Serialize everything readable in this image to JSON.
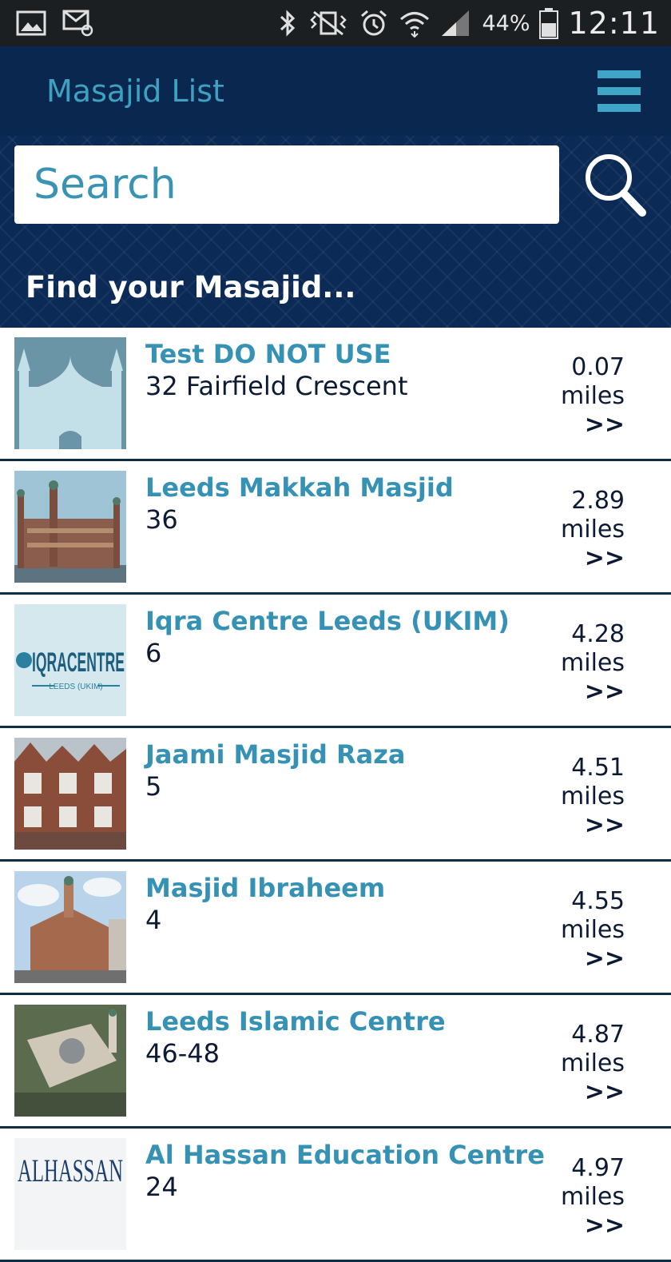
{
  "status_bar": {
    "battery": "44%",
    "time": "12:11",
    "icons": [
      "image-icon",
      "mail-icon",
      "bluetooth-icon",
      "vibrate-icon",
      "alarm-icon",
      "wifi-icon",
      "signal-icon",
      "battery-icon"
    ]
  },
  "app_bar": {
    "title": "Masajid List",
    "menu_icon": "hamburger-menu-icon"
  },
  "search": {
    "placeholder": "Search",
    "icon": "search-icon"
  },
  "hero": {
    "heading": "Find your Masajid..."
  },
  "colors": {
    "app_bar": "#0a2750",
    "accent": "#3fa1c2",
    "name_text": "#3592b4",
    "body_text": "#0d1a33",
    "divider": "#0d2f46"
  },
  "masajid": [
    {
      "name": "Test DO NOT USE",
      "address": "32 Fairfield Crescent",
      "distance": "0.07",
      "unit": "miles",
      "arrow": ">>"
    },
    {
      "name": "Leeds Makkah Masjid",
      "address": "36",
      "distance": "2.89",
      "unit": "miles",
      "arrow": ">>"
    },
    {
      "name": "Iqra Centre Leeds (UKIM)",
      "address": "6",
      "distance": "4.28",
      "unit": "miles",
      "arrow": ">>"
    },
    {
      "name": "Jaami Masjid Raza",
      "address": "5",
      "distance": "4.51",
      "unit": "miles",
      "arrow": ">>"
    },
    {
      "name": "Masjid Ibraheem",
      "address": "4",
      "distance": "4.55",
      "unit": "miles",
      "arrow": ">>"
    },
    {
      "name": "Leeds Islamic Centre",
      "address": "46-48",
      "distance": "4.87",
      "unit": "miles",
      "arrow": ">>"
    },
    {
      "name": "Al Hassan Education Centre",
      "address": "24",
      "distance": "4.97",
      "unit": "miles",
      "arrow": ">>"
    }
  ],
  "thumb_logo_text": {
    "iqra": "IQRACENTRE",
    "iqra_sub": "LEEDS (UKIM)",
    "alhassan": "ALHASSAN"
  }
}
